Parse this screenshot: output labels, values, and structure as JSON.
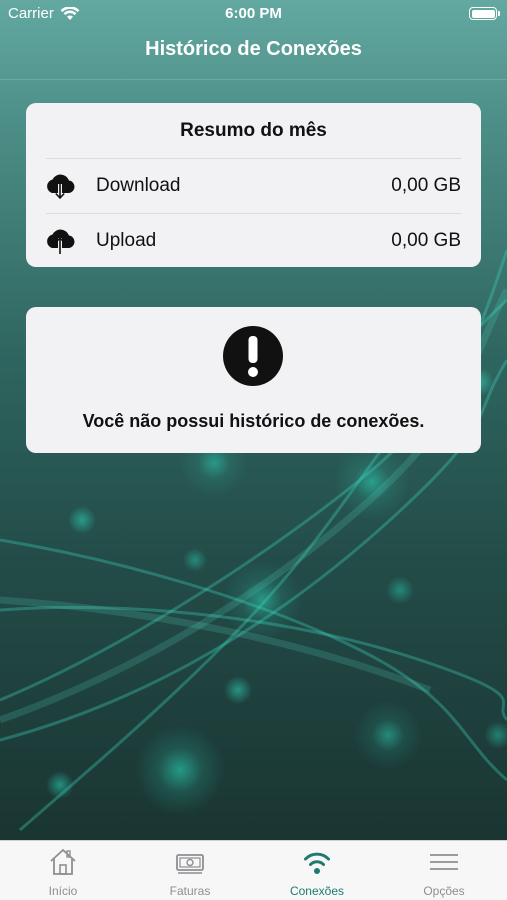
{
  "status_bar": {
    "carrier": "Carrier",
    "time": "6:00 PM",
    "wifi_icon": "wifi-icon",
    "battery_icon": "battery-icon"
  },
  "header": {
    "title": "Histórico de Conexões"
  },
  "summary": {
    "title": "Resumo do mês",
    "rows": [
      {
        "icon": "cloud-download-icon",
        "label": "Download",
        "value": "0,00 GB"
      },
      {
        "icon": "cloud-upload-icon",
        "label": "Upload",
        "value": "0,00 GB"
      }
    ]
  },
  "empty_state": {
    "icon": "alert-icon",
    "message": "Você não possui histórico de conexões."
  },
  "tab_bar": {
    "active_color": "#1f7a70",
    "inactive_color": "#8e8e93",
    "tabs": [
      {
        "icon": "home-icon",
        "label": "Início",
        "active": false
      },
      {
        "icon": "invoice-icon",
        "label": "Faturas",
        "active": false
      },
      {
        "icon": "wifi-icon",
        "label": "Conexões",
        "active": true
      },
      {
        "icon": "menu-icon",
        "label": "Opções",
        "active": false
      }
    ]
  }
}
